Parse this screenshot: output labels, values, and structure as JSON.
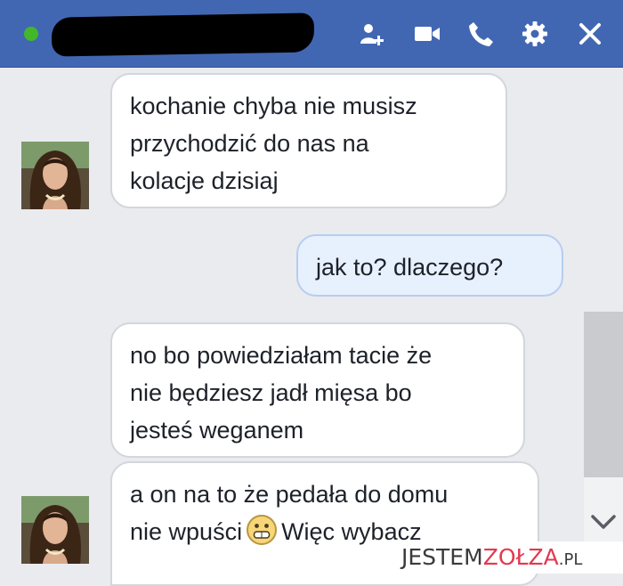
{
  "header": {
    "contact_name": "",
    "icons": [
      "online-status-dot",
      "add-people-icon",
      "video-call-icon",
      "phone-call-icon",
      "gear-icon",
      "close-icon"
    ],
    "colors": {
      "bar": "#4267b2",
      "online": "#42b72a",
      "icon": "#ffffff"
    }
  },
  "messages": [
    {
      "from": "contact",
      "lines": [
        "kochanie chyba nie musisz",
        "przychodzić do nas na",
        "kolacje dzisiaj"
      ]
    },
    {
      "from": "me",
      "lines": [
        "jak to? dlaczego?"
      ]
    },
    {
      "from": "contact",
      "lines": [
        "no bo powiedziałam tacie że",
        "nie będziesz jadł mięsa bo",
        "jesteś weganem"
      ]
    },
    {
      "from": "contact",
      "lines": [
        "a on na to że pedała do domu",
        "nie wpuści",
        "Więc wybacz"
      ],
      "emoji": "grinning-face-icon"
    }
  ],
  "watermark": {
    "part1": "JESTEM",
    "part2": "ZOŁZA",
    "tld": ".PL"
  },
  "colors": {
    "background": "#e9ebee",
    "own_bubble": "#e7f0fd",
    "contact_bubble": "#ffffff"
  }
}
